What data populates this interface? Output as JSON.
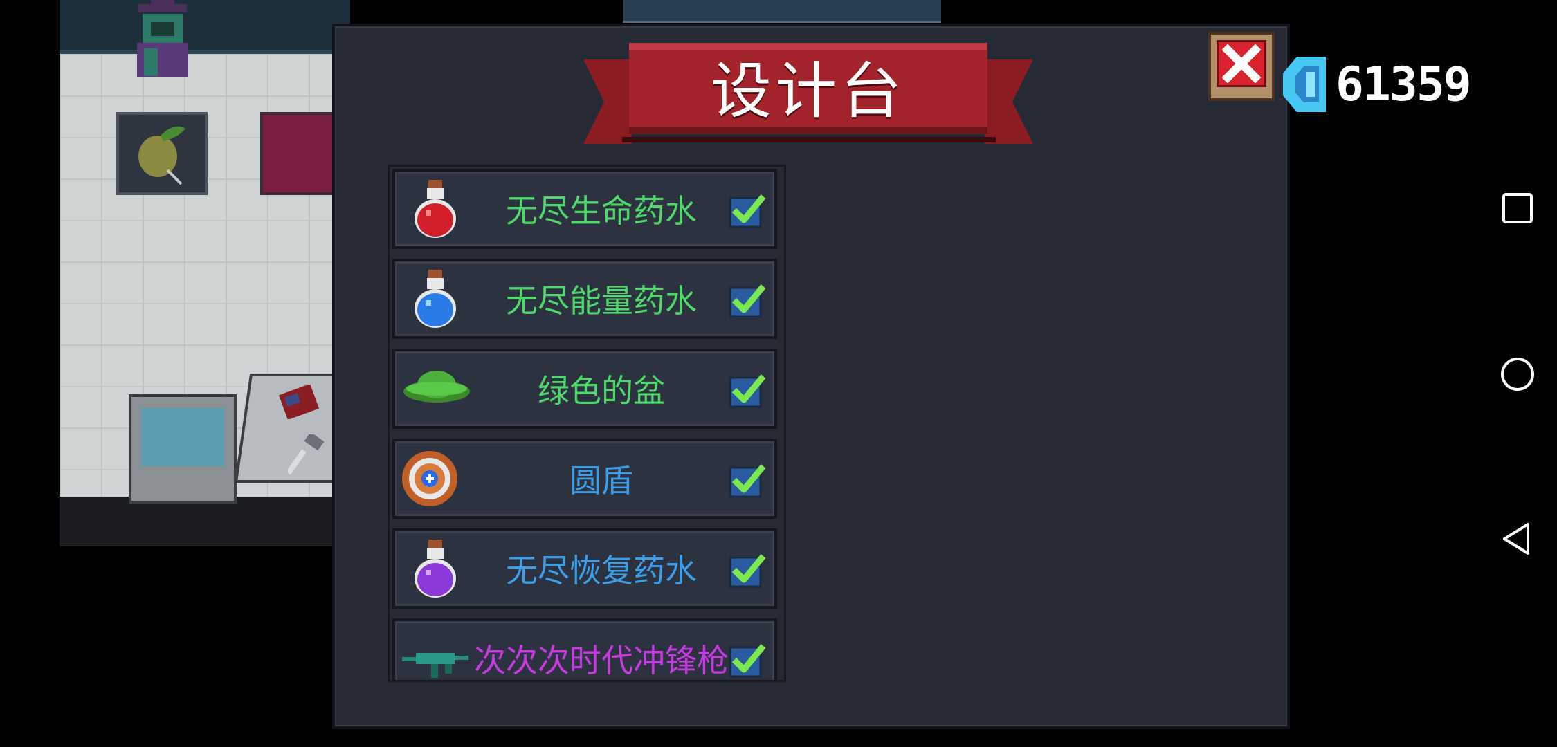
{
  "window": {
    "title": "设计台"
  },
  "currency": {
    "icon": "gem-icon",
    "value": "61359",
    "color": "#46c8f2"
  },
  "close": {
    "icon": "close-icon"
  },
  "items": [
    {
      "name": "无尽生命药水",
      "icon": "red-potion-icon",
      "color": "#4fd96a",
      "checked": true
    },
    {
      "name": "无尽能量药水",
      "icon": "blue-potion-icon",
      "color": "#4fd96a",
      "checked": true
    },
    {
      "name": "绿色的盆",
      "icon": "green-bowl-icon",
      "color": "#4fd96a",
      "checked": true
    },
    {
      "name": "圆盾",
      "icon": "round-shield-icon",
      "color": "#3a9ee8",
      "checked": true
    },
    {
      "name": "无尽恢复药水",
      "icon": "purple-potion-icon",
      "color": "#3a9ee8",
      "checked": true
    },
    {
      "name": "次次次时代冲锋枪",
      "icon": "smg-icon",
      "color": "#c63be0",
      "checked": true
    }
  ],
  "nav_bar": [
    {
      "name": "recent-apps",
      "icon": "square-icon"
    },
    {
      "name": "home",
      "icon": "circle-icon"
    },
    {
      "name": "back",
      "icon": "triangle-back-icon"
    }
  ]
}
